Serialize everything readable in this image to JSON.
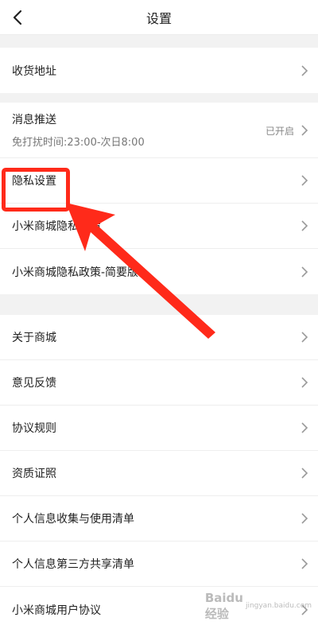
{
  "header": {
    "title": "设置"
  },
  "groups": [
    {
      "items": [
        {
          "label": "收货地址"
        }
      ]
    },
    {
      "items": [
        {
          "label": "消息推送",
          "subtitle": "免打扰时间:23:00-次日8:00",
          "status": "已开启"
        },
        {
          "label": "隐私设置"
        },
        {
          "label": "小米商城隐私政策"
        },
        {
          "label": "小米商城隐私政策-简要版"
        }
      ]
    },
    {
      "items": [
        {
          "label": "关于商城"
        },
        {
          "label": "意见反馈"
        },
        {
          "label": "协议规则"
        },
        {
          "label": "资质证照"
        },
        {
          "label": "个人信息收集与使用清单"
        },
        {
          "label": "个人信息第三方共享清单"
        },
        {
          "label": "小米商城用户协议"
        }
      ]
    }
  ],
  "watermark": {
    "logo": "Baidu 经验",
    "url": "jingyan.baidu.com"
  },
  "colors": {
    "annotation": "#ff2a1a",
    "background": "#f2f2f2",
    "row": "#ffffff"
  }
}
